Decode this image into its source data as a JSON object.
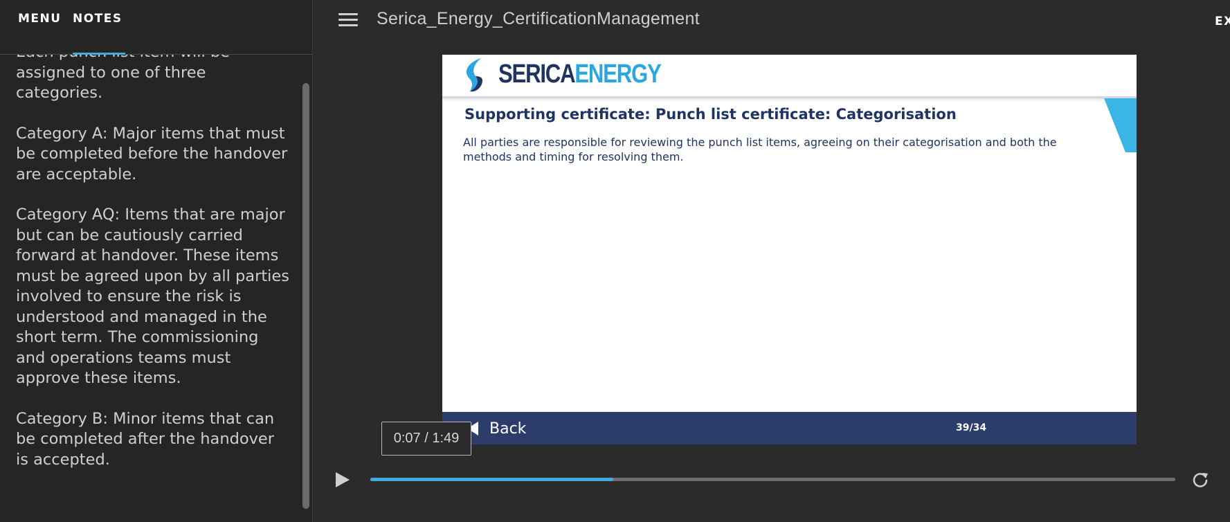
{
  "sidebar": {
    "tabs": {
      "menu": "MENU",
      "notes": "NOTES"
    },
    "notes": [
      "Each punch list item will be assigned to one of three categories.",
      "Category A: Major items that must be completed before the handover are acceptable.",
      "Category AQ: Items that are major but can be cautiously carried forward at handover. These items must be agreed upon by all parties involved to ensure the risk is understood and managed in the short term. The commissioning and operations teams must approve these items.",
      "Category B: Minor items that can be completed after the handover is accepted."
    ]
  },
  "header": {
    "course_title": "Serica_Energy_CertificationManagement",
    "exit_label": "EX"
  },
  "slide": {
    "logo": {
      "word1": "SERICA",
      "word2": "ENERGY"
    },
    "title": "Supporting certificate: Punch list certificate: Categorisation",
    "body": "All parties are responsible for reviewing the punch list items, agreeing on their categorisation and both the methods and timing for resolving them.",
    "footer": {
      "back_label": "Back",
      "page_counter": "39/34"
    }
  },
  "player": {
    "time_display": "0:07 / 1:49",
    "progress_fraction": 0.302
  },
  "colors": {
    "accent": "#3fa9e0",
    "brand_navy": "#1f3461",
    "brand_blue": "#2aa6e0",
    "footer_bar": "#2c3d6b",
    "background": "#2b2b2b"
  },
  "icons": {
    "hamburger": "hamburger-menu-icon",
    "play": "play-icon",
    "replay": "replay-icon",
    "back": "back-arrow-icon"
  }
}
